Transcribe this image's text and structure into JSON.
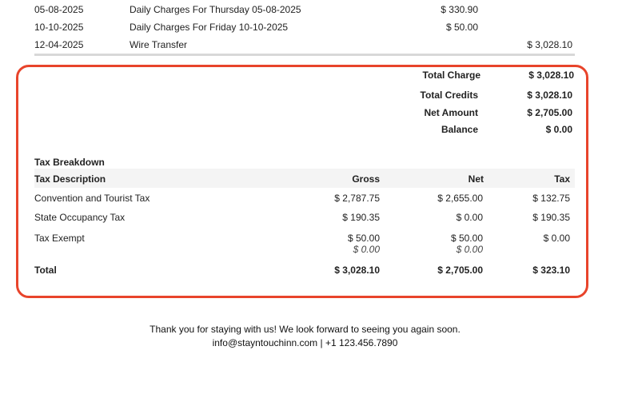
{
  "charges": [
    {
      "date": "05-08-2025",
      "description": "Daily Charges For Thursday 05-08-2025",
      "charge": "$ 330.90",
      "credit": ""
    },
    {
      "date": "10-10-2025",
      "description": "Daily Charges For Friday 10-10-2025",
      "charge": "$ 50.00",
      "credit": ""
    },
    {
      "date": "12-04-2025",
      "description": "Wire Transfer",
      "charge": "",
      "credit": "$ 3,028.10"
    }
  ],
  "summary": {
    "total_charge_label": "Total Charge",
    "total_charge": "$ 3,028.10",
    "total_credits_label": "Total Credits",
    "total_credits": "$ 3,028.10",
    "net_amount_label": "Net Amount",
    "net_amount": "$ 2,705.00",
    "balance_label": "Balance",
    "balance": "$ 0.00"
  },
  "tax": {
    "title": "Tax Breakdown",
    "headers": {
      "description": "Tax Description",
      "gross": "Gross",
      "net": "Net",
      "tax": "Tax"
    },
    "rows": [
      {
        "description": "Convention and Tourist Tax",
        "gross": "$ 2,787.75",
        "net": "$ 2,655.00",
        "tax": "$ 132.75"
      },
      {
        "description": "State Occupancy Tax",
        "gross": "$ 190.35",
        "net": "$ 0.00",
        "tax": "$ 190.35"
      },
      {
        "description": "Tax Exempt",
        "gross": "$ 50.00",
        "gross_sub": "$ 0.00",
        "net": "$ 50.00",
        "net_sub": "$ 0.00",
        "tax": "$ 0.00"
      }
    ],
    "total": {
      "label": "Total",
      "gross": "$ 3,028.10",
      "net": "$ 2,705.00",
      "tax": "$ 323.10"
    }
  },
  "footer": {
    "thanks": "Thank you for staying with us! We look forward to seeing you again soon.",
    "contact": "info@stayntouchinn.com | +1 123.456.7890"
  },
  "colors": {
    "highlight_border": "#e8442b",
    "header_row_bg": "#f4f4f4",
    "divider": "#d8d8d8"
  }
}
